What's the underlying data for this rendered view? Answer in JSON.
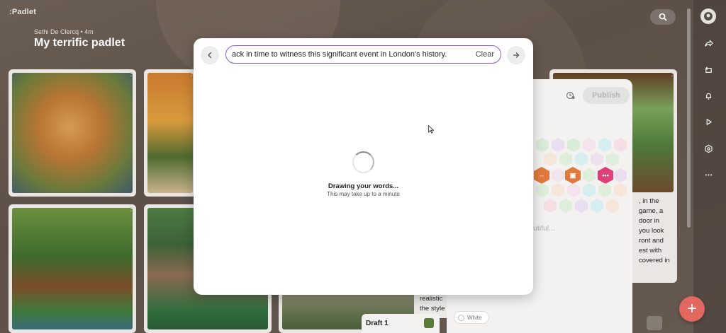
{
  "app": {
    "brand": ":Padlet",
    "author_line": "Sethi De Clercq • 4m",
    "title": "My terrific padlet"
  },
  "modal": {
    "prompt_value": "ack in time to witness this significant event in London's history.",
    "clear_label": "Clear",
    "loading_title": "Drawing your words...",
    "loading_subtitle": "This may take up to a minute"
  },
  "composer": {
    "publish_label": "Publish",
    "placeholder_fragment": "utiful...",
    "color_chip_label": "White"
  },
  "draft": {
    "label": "Draft 1"
  },
  "background_text": {
    "card_right_lines": [
      ", in the",
      "game, a",
      "door in",
      "you look",
      "ront and",
      "est with",
      "covered in"
    ],
    "card_mid_lines": [
      "realistic",
      "the style"
    ]
  },
  "colors": {
    "accent_purple": "#8a5ad6",
    "fab_red": "#e2675f",
    "hex_orange": "#e07a3c",
    "hex_pink": "#e23e7a"
  },
  "icons": {
    "search": "search-icon",
    "back": "arrow-left-icon",
    "forward": "arrow-right-icon",
    "share": "share-icon",
    "remake": "remake-icon",
    "bell": "bell-icon",
    "slideshow": "play-icon",
    "settings": "settings-icon",
    "more": "more-icon",
    "add": "plus-icon"
  }
}
